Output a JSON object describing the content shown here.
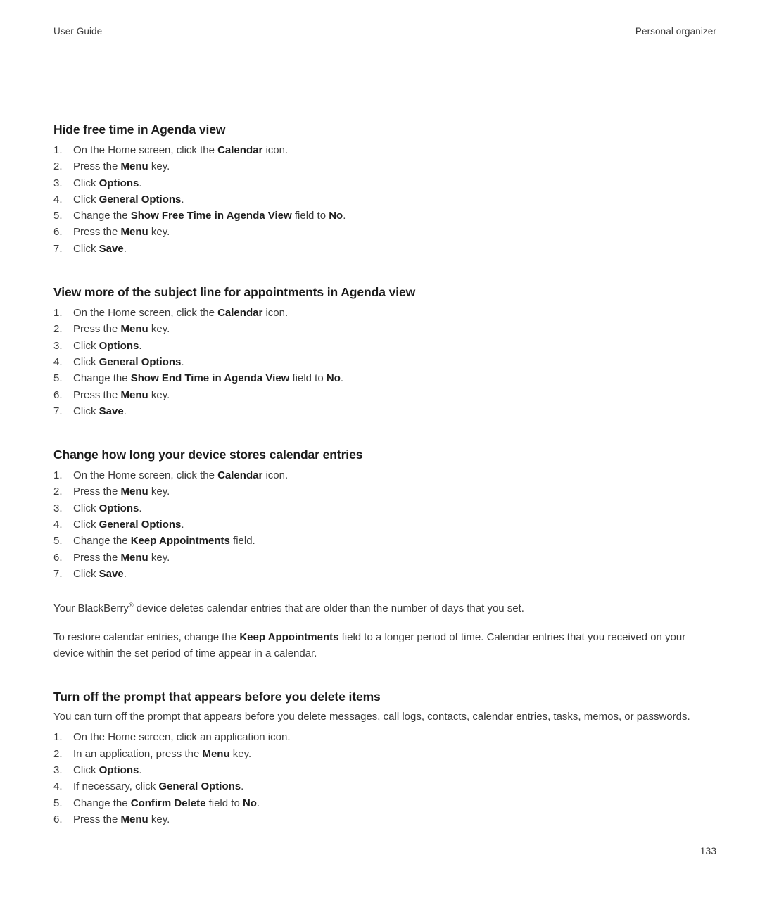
{
  "header": {
    "left": "User Guide",
    "right": "Personal organizer"
  },
  "footer": {
    "page_number": "133"
  },
  "sections": [
    {
      "heading": "Hide free time in Agenda view",
      "steps": [
        {
          "plain_1": "On the Home screen, click the ",
          "bold_1": "Calendar",
          "plain_2": " icon."
        },
        {
          "plain_1": "Press the ",
          "bold_1": "Menu",
          "plain_2": " key."
        },
        {
          "plain_1": "Click ",
          "bold_1": "Options",
          "plain_2": "."
        },
        {
          "plain_1": "Click ",
          "bold_1": "General Options",
          "plain_2": "."
        },
        {
          "plain_1": "Change the ",
          "bold_1": "Show Free Time in Agenda View",
          "plain_2": " field to ",
          "bold_2": "No",
          "plain_3": "."
        },
        {
          "plain_1": "Press the ",
          "bold_1": "Menu",
          "plain_2": " key."
        },
        {
          "plain_1": "Click ",
          "bold_1": "Save",
          "plain_2": "."
        }
      ]
    },
    {
      "heading": "View more of the subject line for appointments in Agenda view",
      "steps": [
        {
          "plain_1": "On the Home screen, click the ",
          "bold_1": "Calendar",
          "plain_2": " icon."
        },
        {
          "plain_1": "Press the ",
          "bold_1": "Menu",
          "plain_2": " key."
        },
        {
          "plain_1": "Click ",
          "bold_1": "Options",
          "plain_2": "."
        },
        {
          "plain_1": "Click ",
          "bold_1": "General Options",
          "plain_2": "."
        },
        {
          "plain_1": "Change the ",
          "bold_1": "Show End Time in Agenda View",
          "plain_2": " field to ",
          "bold_2": "No",
          "plain_3": "."
        },
        {
          "plain_1": "Press the ",
          "bold_1": "Menu",
          "plain_2": " key."
        },
        {
          "plain_1": "Click ",
          "bold_1": "Save",
          "plain_2": "."
        }
      ]
    },
    {
      "heading": "Change how long your device stores calendar entries",
      "steps": [
        {
          "plain_1": "On the Home screen, click the ",
          "bold_1": "Calendar",
          "plain_2": " icon."
        },
        {
          "plain_1": "Press the ",
          "bold_1": "Menu",
          "plain_2": " key."
        },
        {
          "plain_1": "Click ",
          "bold_1": "Options",
          "plain_2": "."
        },
        {
          "plain_1": "Click ",
          "bold_1": "General Options",
          "plain_2": "."
        },
        {
          "plain_1": "Change the ",
          "bold_1": "Keep Appointments",
          "plain_2": " field."
        },
        {
          "plain_1": "Press the ",
          "bold_1": "Menu",
          "plain_2": " key."
        },
        {
          "plain_1": "Click ",
          "bold_1": "Save",
          "plain_2": "."
        }
      ],
      "paragraphs": [
        {
          "plain_1": "Your BlackBerry",
          "superscript": "®",
          "plain_2": " device deletes calendar entries that are older than the number of days that you set."
        },
        {
          "plain_1": "To restore calendar entries, change the ",
          "bold_1": "Keep Appointments",
          "plain_2": " field to a longer period of time. Calendar entries that you received on your device within the set period of time appear in a calendar."
        }
      ]
    },
    {
      "heading": "Turn off the prompt that appears before you delete items",
      "intro": "You can turn off the prompt that appears before you delete messages, call logs, contacts, calendar entries, tasks, memos, or passwords.",
      "steps": [
        {
          "plain_1": "On the Home screen, click an application icon."
        },
        {
          "plain_1": "In an application, press the ",
          "bold_1": "Menu",
          "plain_2": " key."
        },
        {
          "plain_1": "Click ",
          "bold_1": "Options",
          "plain_2": "."
        },
        {
          "plain_1": "If necessary, click ",
          "bold_1": "General Options",
          "plain_2": "."
        },
        {
          "plain_1": "Change the ",
          "bold_1": "Confirm Delete",
          "plain_2": " field to ",
          "bold_2": "No",
          "plain_3": "."
        },
        {
          "plain_1": "Press the ",
          "bold_1": "Menu",
          "plain_2": " key."
        }
      ]
    }
  ]
}
